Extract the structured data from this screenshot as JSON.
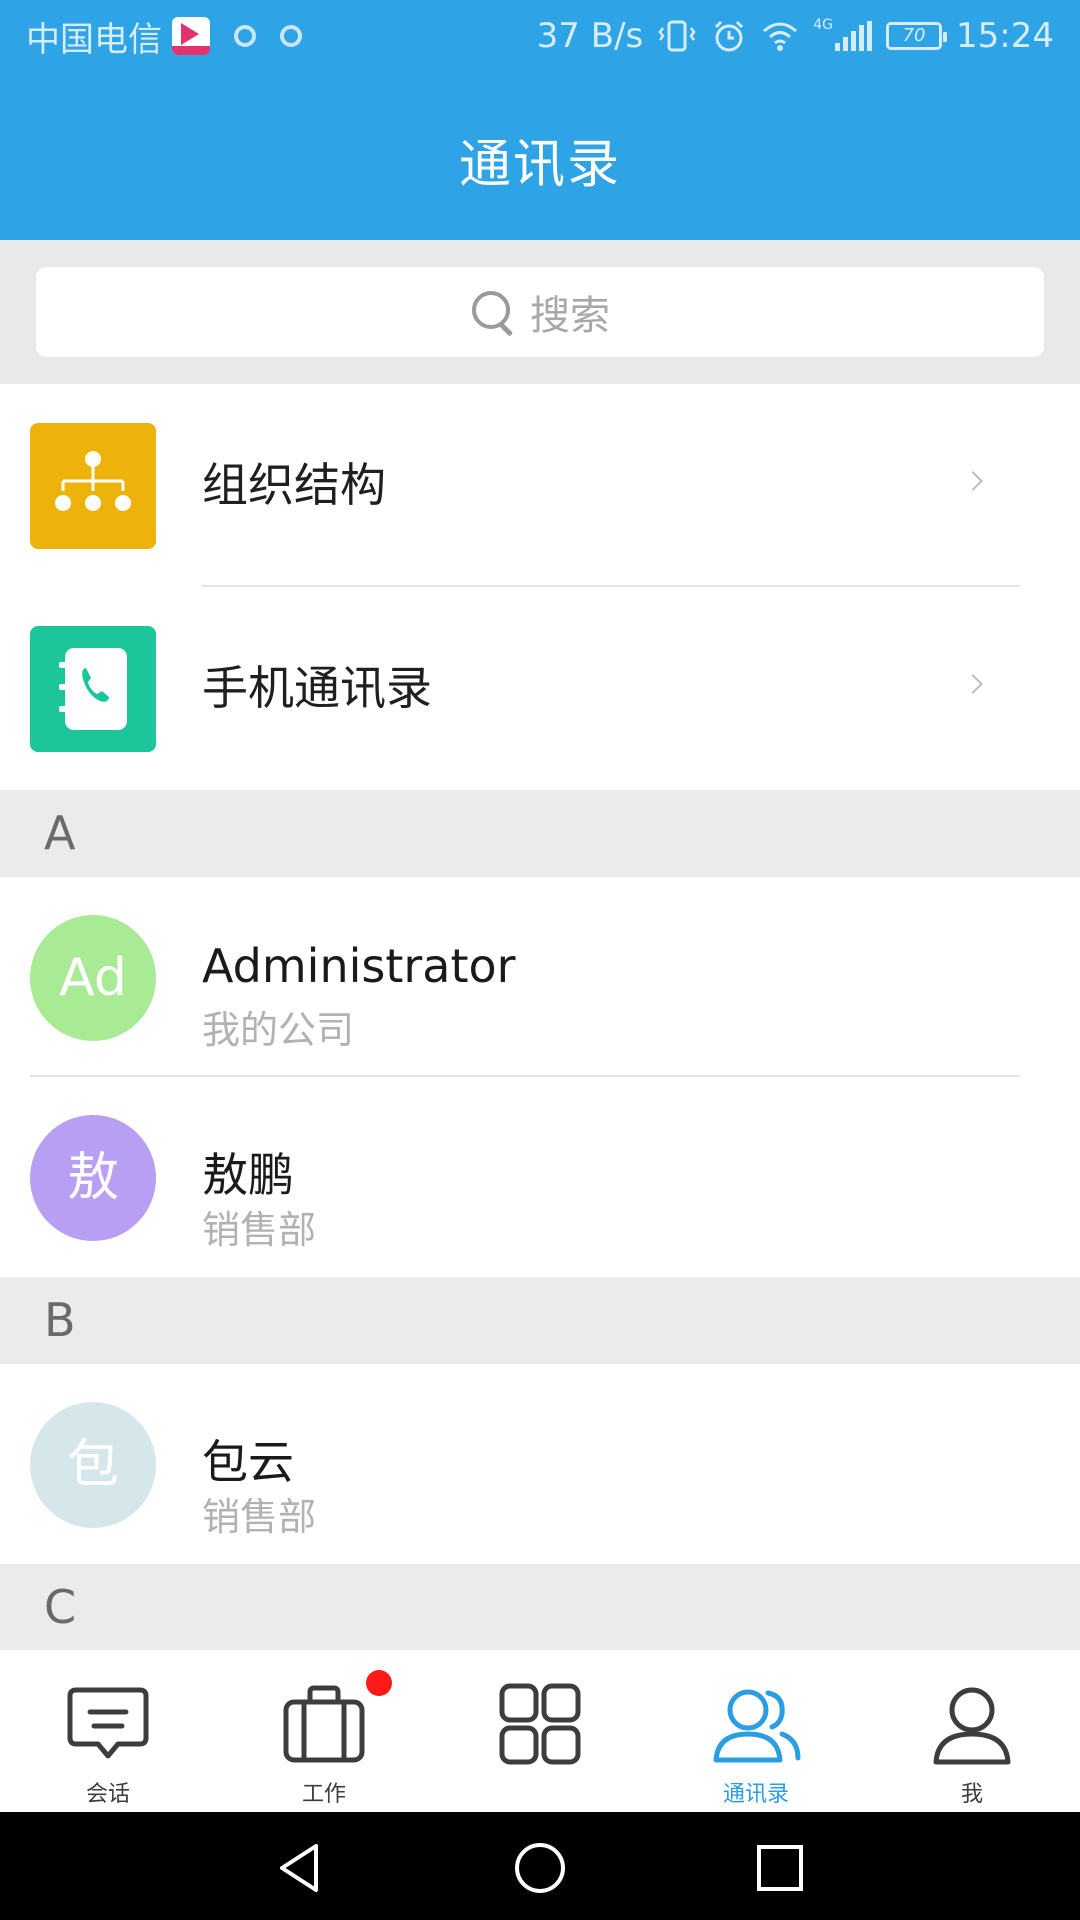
{
  "status_bar": {
    "carrier": "中国电信",
    "net_speed": "37 B/s",
    "network_type": "4G",
    "battery": "70",
    "time": "15:24"
  },
  "header": {
    "title": "通讯录"
  },
  "search": {
    "placeholder": "搜索"
  },
  "features": [
    {
      "label": "组织结构",
      "icon": "org-chart-icon",
      "color": "#edb30a"
    },
    {
      "label": "手机通讯录",
      "icon": "phone-book-icon",
      "color": "#1cc69a"
    }
  ],
  "sections": [
    {
      "letter": "A",
      "contacts": [
        {
          "avatar_text": "Ad",
          "avatar_color": "#a9ea95",
          "name": "Administrator",
          "dept": "我的公司"
        },
        {
          "avatar_text": "敖",
          "avatar_color": "#b89ff3",
          "name": "敖鹏",
          "dept": "销售部"
        }
      ]
    },
    {
      "letter": "B",
      "contacts": [
        {
          "avatar_text": "包",
          "avatar_color": "#d6e7ec",
          "name": "包云",
          "dept": "销售部"
        }
      ]
    },
    {
      "letter": "C",
      "contacts": []
    }
  ],
  "tab_bar": {
    "active_color": "#2a9de3",
    "tabs": [
      {
        "label": "会话",
        "icon": "chat-icon",
        "badge": false
      },
      {
        "label": "工作",
        "icon": "briefcase-icon",
        "badge": true
      },
      {
        "label": "",
        "icon": "apps-grid-icon",
        "badge": false
      },
      {
        "label": "通讯录",
        "icon": "contacts-icon",
        "badge": false,
        "active": true
      },
      {
        "label": "我",
        "icon": "profile-icon",
        "badge": false
      }
    ]
  }
}
